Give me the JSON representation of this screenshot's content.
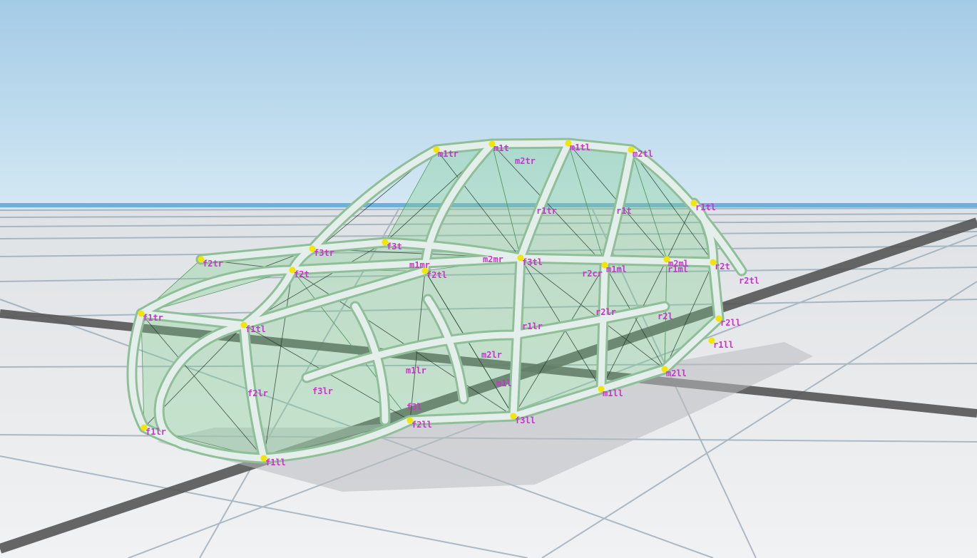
{
  "colors": {
    "sky_top": "#a4cbe6",
    "sky_bottom": "#d4e8f4",
    "horizon": "#6fb0d9",
    "ground": "#e9ebed",
    "grid_line": "#8fa3b3",
    "grid_dark": "#545454",
    "tube": "#e4eeea",
    "tube_shade": "#8fbf98",
    "panel_fill": "#7fcf8e",
    "node": "#f2e600",
    "label": "#cc33cc"
  },
  "nodes": [
    {
      "id": "m1tr",
      "label": "m1tr"
    },
    {
      "id": "m1t",
      "label": "m1t"
    },
    {
      "id": "m1tl",
      "label": "m1tl"
    },
    {
      "id": "m2tl",
      "label": "m2tl"
    },
    {
      "id": "m2tr",
      "label": "m2tr"
    },
    {
      "id": "r1tr",
      "label": "r1tr"
    },
    {
      "id": "r1t",
      "label": "r1t"
    },
    {
      "id": "r1tl",
      "label": "r1tl"
    },
    {
      "id": "f2tr",
      "label": "f2tr"
    },
    {
      "id": "f3tr",
      "label": "f3tr"
    },
    {
      "id": "f3t",
      "label": "f3t"
    },
    {
      "id": "f2t",
      "label": "f2t"
    },
    {
      "id": "m1mr",
      "label": "m1mr"
    },
    {
      "id": "m2mr",
      "label": "m2mr"
    },
    {
      "id": "f2tl",
      "label": "f2tl"
    },
    {
      "id": "f3tl",
      "label": "f3tl"
    },
    {
      "id": "f1tr",
      "label": "f1tr"
    },
    {
      "id": "f1tl",
      "label": "f1tl"
    },
    {
      "id": "r2cr",
      "label": "r2cr"
    },
    {
      "id": "m1ml",
      "label": "m1ml"
    },
    {
      "id": "m2ml",
      "label": "m2ml"
    },
    {
      "id": "r2t",
      "label": "r2t"
    },
    {
      "id": "r1ml",
      "label": "r1ml"
    },
    {
      "id": "r2tl",
      "label": "r2tl"
    },
    {
      "id": "r2lr",
      "label": "r2lr"
    },
    {
      "id": "r2l",
      "label": "r2l"
    },
    {
      "id": "r1lr",
      "label": "r1lr"
    },
    {
      "id": "r2ll",
      "label": "r2ll"
    },
    {
      "id": "r1ll",
      "label": "r1ll"
    },
    {
      "id": "m2lr",
      "label": "m2lr"
    },
    {
      "id": "m1lr",
      "label": "m1lr"
    },
    {
      "id": "m1l",
      "label": "m1l"
    },
    {
      "id": "m2ll",
      "label": "m2ll"
    },
    {
      "id": "m1ll",
      "label": "m1ll"
    },
    {
      "id": "f2lr",
      "label": "f2lr"
    },
    {
      "id": "f3lr",
      "label": "f3lr"
    },
    {
      "id": "f3l",
      "label": "f3l"
    },
    {
      "id": "f2ll",
      "label": "f2ll"
    },
    {
      "id": "f3ll",
      "label": "f3ll"
    },
    {
      "id": "f1lr",
      "label": "f1lr"
    },
    {
      "id": "f1ll",
      "label": "f1ll"
    }
  ]
}
